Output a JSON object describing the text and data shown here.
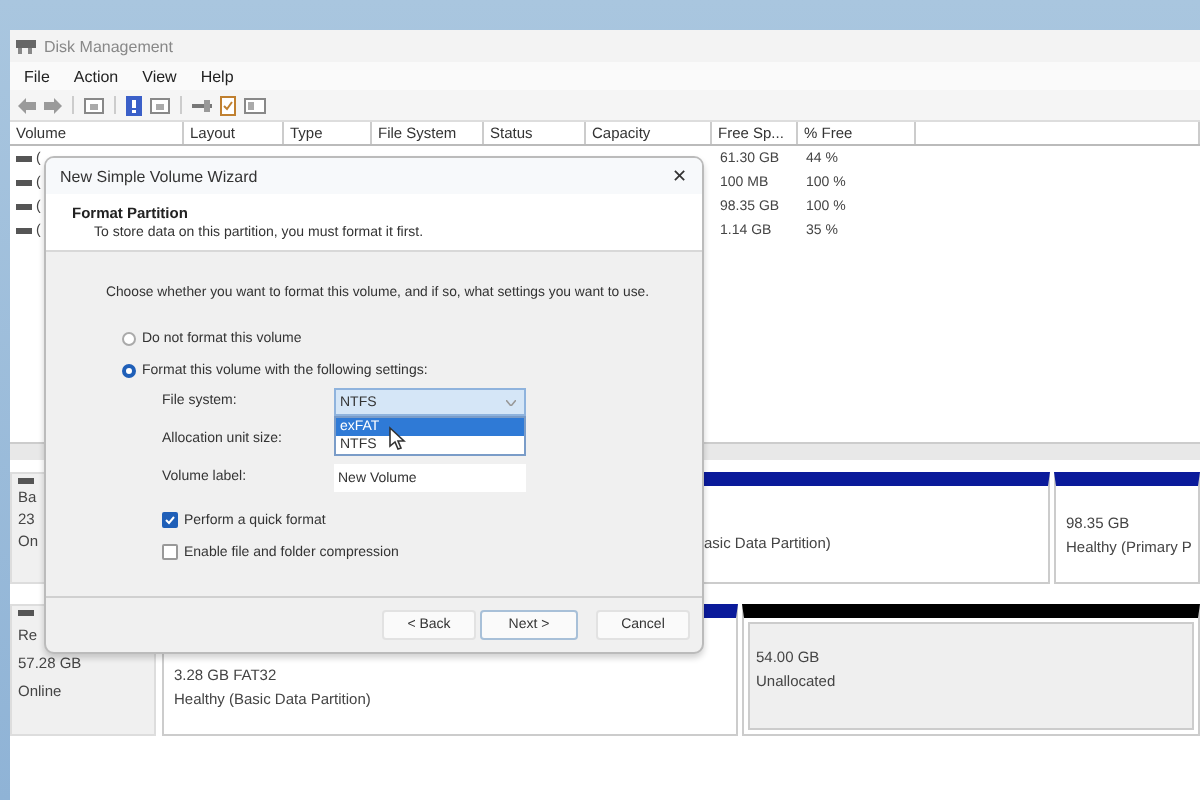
{
  "window": {
    "title": "Disk Management"
  },
  "menu": [
    "File",
    "Action",
    "View",
    "Help"
  ],
  "table": {
    "columns": [
      "Volume",
      "Layout",
      "Type",
      "File System",
      "Status",
      "Capacity",
      "Free Sp...",
      "% Free"
    ],
    "rows": [
      {
        "volume": "(",
        "free": "61.30 GB",
        "pct": "44 %"
      },
      {
        "volume": "(",
        "free": "100 MB",
        "pct": "100 %"
      },
      {
        "volume": "(",
        "free": "98.35 GB",
        "pct": "100 %"
      },
      {
        "volume": "(",
        "free": "1.14 GB",
        "pct": "35 %"
      }
    ]
  },
  "disks": [
    {
      "lines": [
        "Ba",
        "23",
        "On"
      ],
      "partitions": [
        {
          "kind": "primary",
          "lines": [
            "asic Data Partition)"
          ]
        },
        {
          "kind": "primary",
          "lines": [
            "98.35 GB",
            "Healthy (Primary P"
          ]
        }
      ]
    },
    {
      "lines": [
        "Re",
        "57.28 GB",
        "Online"
      ],
      "partitions": [
        {
          "kind": "primary",
          "lines": [
            "3.28 GB FAT32",
            "Healthy (Basic Data Partition)"
          ]
        },
        {
          "kind": "unallocated",
          "lines": [
            "54.00 GB",
            "Unallocated"
          ]
        }
      ]
    }
  ],
  "dialog": {
    "title": "New Simple Volume Wizard",
    "close": "✕",
    "heading": "Format Partition",
    "subheading": "To store data on this partition, you must format it first.",
    "prompt": "Choose whether you want to format this volume, and if so, what settings you want to use.",
    "options": [
      {
        "label": "Do not format this volume",
        "selected": false
      },
      {
        "label": "Format this volume with the following settings:",
        "selected": true
      }
    ],
    "file_system": {
      "label": "File system:",
      "value": "NTFS",
      "expanded": true,
      "options": [
        {
          "label": "exFAT",
          "highlighted": true
        },
        {
          "label": "NTFS",
          "highlighted": false
        }
      ]
    },
    "allocation": {
      "label": "Allocation unit size:"
    },
    "volume_label": {
      "label": "Volume label:",
      "value": "New Volume"
    },
    "checkboxes": [
      {
        "label": "Perform a quick format",
        "checked": true
      },
      {
        "label": "Enable file and folder compression",
        "checked": false
      }
    ],
    "buttons": [
      {
        "label": "< Back",
        "default": false
      },
      {
        "label": "Next >",
        "default": true
      },
      {
        "label": "Cancel",
        "default": false
      }
    ]
  }
}
